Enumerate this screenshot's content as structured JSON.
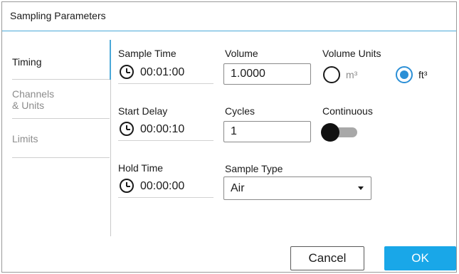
{
  "dialog": {
    "title": "Sampling Parameters"
  },
  "nav": {
    "items": [
      {
        "label": "Timing",
        "active": true
      },
      {
        "label_line1": "Channels",
        "label_line2": "& Units",
        "active": false
      },
      {
        "label": "Limits",
        "active": false
      }
    ]
  },
  "timing": {
    "sample_time": {
      "label": "Sample Time",
      "value": "00:01:00"
    },
    "start_delay": {
      "label": "Start Delay",
      "value": "00:00:10"
    },
    "hold_time": {
      "label": "Hold Time",
      "value": "00:00:00"
    },
    "volume": {
      "label": "Volume",
      "value": "1.0000"
    },
    "cycles": {
      "label": "Cycles",
      "value": "1"
    },
    "sample_type": {
      "label": "Sample Type",
      "value": "Air"
    },
    "volume_units": {
      "label": "Volume Units",
      "options": [
        {
          "label": "m³",
          "selected": false
        },
        {
          "label": "ft³",
          "selected": true
        }
      ]
    },
    "continuous": {
      "label": "Continuous",
      "enabled": false
    }
  },
  "buttons": {
    "cancel": "Cancel",
    "ok": "OK"
  },
  "colors": {
    "accent": "#19a7e8",
    "selected_radio": "#2b8fd6",
    "toggle_track": "#a8a8a8"
  }
}
